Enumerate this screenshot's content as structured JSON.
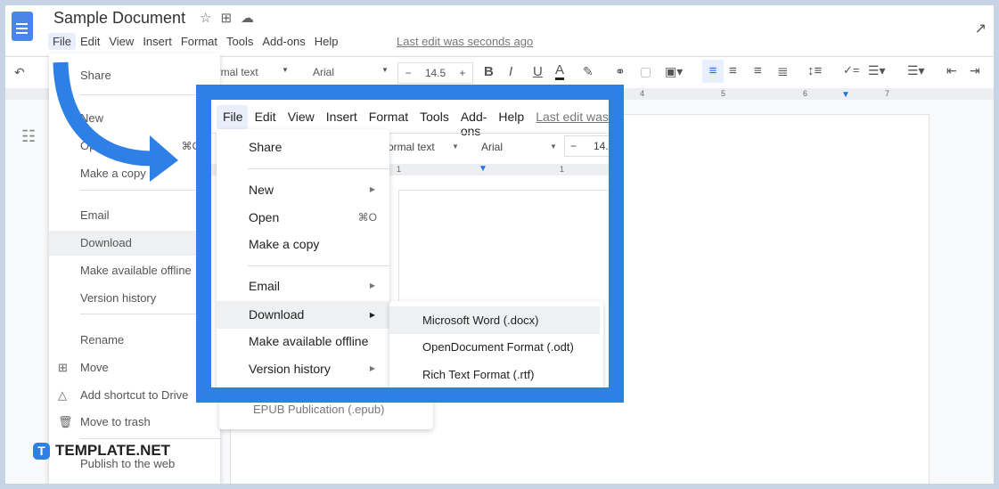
{
  "doc": {
    "title": "Sample Document",
    "last_edit": "Last edit was seconds ago"
  },
  "menubar": [
    "File",
    "Edit",
    "View",
    "Insert",
    "Format",
    "Tools",
    "Add-ons",
    "Help"
  ],
  "toolbar": {
    "style": "Normal text",
    "style_visible": "ormal text",
    "font": "Arial",
    "size": "14.5",
    "minus": "−",
    "plus": "+",
    "bold": "B",
    "italic": "I",
    "underline": "U",
    "color": "A"
  },
  "ruler": {
    "ticks": [
      "4",
      "5",
      "6",
      "7"
    ],
    "inner_ticks": [
      "1",
      "1"
    ]
  },
  "file_menu": {
    "share": "Share",
    "new": "New",
    "open": "Open",
    "open_shortcut": "⌘O",
    "copy": "Make a copy",
    "email": "Email",
    "download": "Download",
    "offline": "Make available offline",
    "version": "Version history",
    "rename": "Rename",
    "move": "Move",
    "shortcut": "Add shortcut to Drive",
    "trash": "Move to trash",
    "publish": "Publish to the web"
  },
  "download_menu": [
    "Microsoft Word (.docx)",
    "OpenDocument Format (.odt)",
    "Rich Text Format (.rtf)",
    "EPUB Publication (.epub)"
  ],
  "brand": {
    "name": "TEMPLATE.NET",
    "mark": "T"
  },
  "colors": {
    "accent": "#2f80e6",
    "docs_blue": "#4a86e8"
  }
}
